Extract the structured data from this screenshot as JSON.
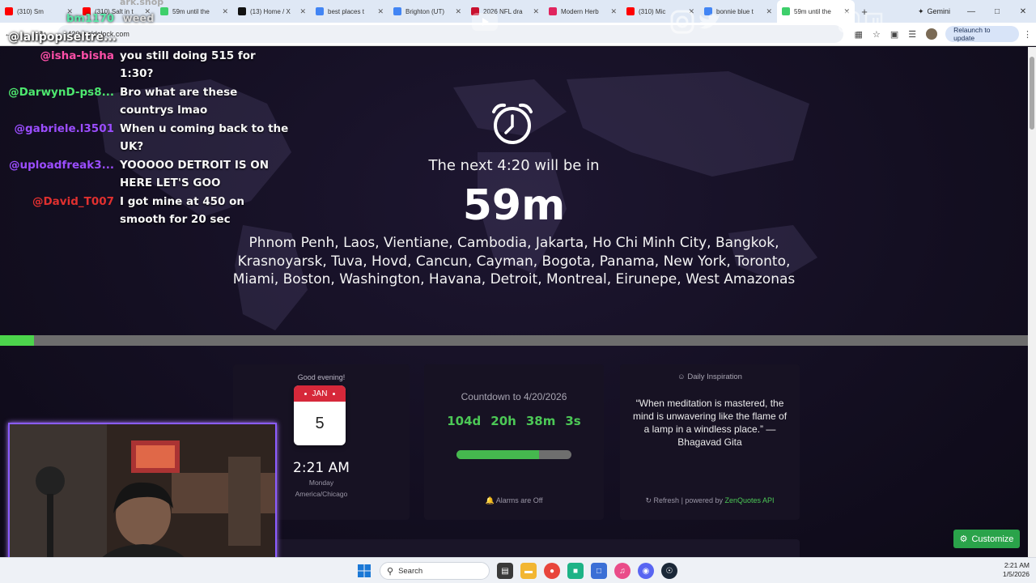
{
  "browser": {
    "tabs": [
      {
        "label": "(310) Sm",
        "color": "#ff0000"
      },
      {
        "label": "(310) Salt in t",
        "color": "#ff0000"
      },
      {
        "label": "59m until the",
        "color": "#3ecf6b"
      },
      {
        "label": "(13) Home / X",
        "color": "#111111"
      },
      {
        "label": "best places t",
        "color": "#4285f4"
      },
      {
        "label": "Brighton (UT)",
        "color": "#4285f4"
      },
      {
        "label": "2026 NFL dra",
        "color": "#c8102e"
      },
      {
        "label": "Modern Herb",
        "color": "#e0245e"
      },
      {
        "label": "(310) Mic",
        "color": "#ff0000"
      },
      {
        "label": "bonnie blue t",
        "color": "#4285f4"
      },
      {
        "label": "59m until the",
        "color": "#3ecf6b"
      }
    ],
    "active_tab_index": 10,
    "gemini_label": "Gemini",
    "url": "420worldclock.com",
    "relaunch_label": "Relaunch to update"
  },
  "hero": {
    "next_label": "The next 4:20 will be in",
    "countdown": "59m",
    "cities": "Phnom Penh, Laos, Vientiane, Cambodia, Jakarta, Ho Chi Minh City, Bangkok, Krasnoyarsk, Tuva, Hovd, Cancun, Cayman, Bogota, Panama, New York, Toronto, Miami, Boston, Washington, Havana, Detroit, Montreal, Eirunepe, West Amazonas",
    "progress": 0.033
  },
  "clock_card": {
    "greeting": "Good evening!",
    "month": "JAN",
    "day": "5",
    "time": "2:21 AM",
    "weekday": "Monday",
    "timezone": "America/Chicago"
  },
  "countdown_card": {
    "title": "Countdown to 4/20/2026",
    "days": "104d",
    "hours": "20h",
    "minutes": "38m",
    "seconds": "3s",
    "progress": 0.72,
    "alarm_status": "Alarms are Off"
  },
  "inspiration_card": {
    "title": "Daily Inspiration",
    "quote": "“When meditation is mastered, the mind is unwavering like the flame of a lamp in a windless place.” — Bhagavad Gita",
    "refresh_label": "Refresh",
    "powered_label": "powered by",
    "api_name": "ZenQuotes API"
  },
  "customize_label": "Customize",
  "stream": {
    "handle": "@lalipopiseltre...",
    "label": "bm1170",
    "label2": "weed",
    "shop": "ark.shop",
    "chat": [
      {
        "user": "@isha-bisha",
        "msg": "you still doing 515 for 1:30?",
        "color": "#ff4fa8"
      },
      {
        "user": "@DarwynD-ps8...",
        "msg": "Bro what are these countrys lmao",
        "color": "#4ee86f"
      },
      {
        "user": "@gabriele.l3501",
        "msg": "When u coming back to the UK?",
        "color": "#9b4dff"
      },
      {
        "user": "@uploadfreak3...",
        "msg": "YOOOOO DETROIT IS ON HERE LET'S GOO",
        "color": "#9b4dff"
      },
      {
        "user": "@David_T007",
        "msg": "I got mine at 450 on smooth for 20 sec",
        "color": "#e0302f"
      }
    ]
  },
  "taskbar": {
    "search_label": "Search",
    "time": "2:21 AM",
    "date": "1/5/2026"
  }
}
